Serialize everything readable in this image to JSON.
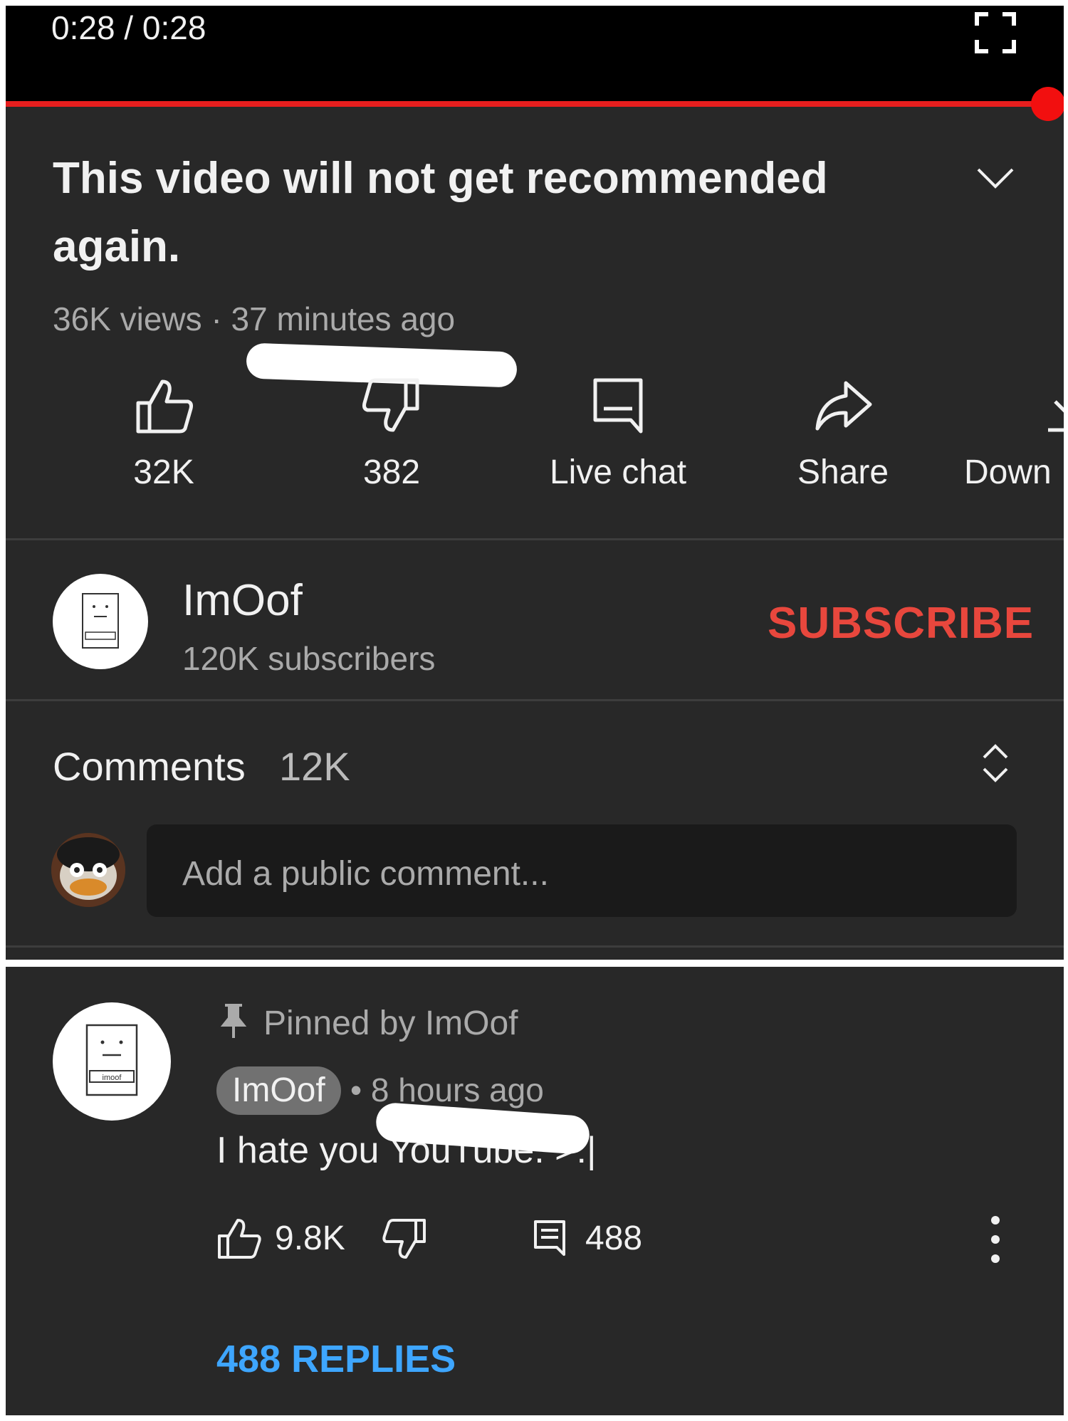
{
  "player": {
    "time": "0:28 / 0:28",
    "progress_fraction": 1.0
  },
  "video": {
    "title": "This video will not get recommended again.",
    "views": "36K views",
    "separator": "·",
    "age": "37 minutes ago"
  },
  "actions": [
    {
      "icon": "thumbs-up-icon",
      "label": "32K"
    },
    {
      "icon": "thumbs-down-icon",
      "label": "382"
    },
    {
      "icon": "live-chat-icon",
      "label": "Live chat"
    },
    {
      "icon": "share-icon",
      "label": "Share"
    },
    {
      "icon": "download-icon",
      "label": "Down"
    }
  ],
  "channel": {
    "name": "ImOof",
    "subscribers": "120K subscribers",
    "subscribe_label": "SUBSCRIBE"
  },
  "comments": {
    "label": "Comments",
    "count": "12K",
    "input_placeholder": "Add a public comment..."
  },
  "pinned_comment": {
    "pinned_label": "Pinned by ImOof",
    "author": "ImOof",
    "time": "• 8 hours ago",
    "text": "I hate you YouTube. >:|",
    "likes": "9.8K",
    "reply_count": "488",
    "replies_link": "488 REPLIES",
    "avatar_caption": "imoof"
  },
  "colors": {
    "background": "#282828",
    "progress": "#f20f0f",
    "subscribe": "#e8473d",
    "link": "#3ea6ff"
  }
}
